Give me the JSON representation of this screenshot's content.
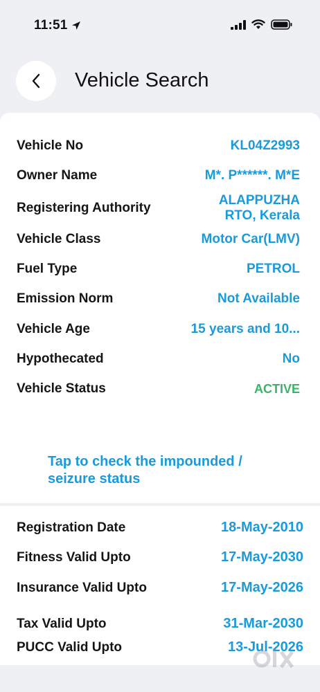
{
  "status_bar": {
    "time": "11:51"
  },
  "header": {
    "title": "Vehicle Search"
  },
  "details": [
    {
      "label": "Vehicle No",
      "value": "KL04Z2993"
    },
    {
      "label": "Owner Name",
      "value": "M*. P******. M*E"
    },
    {
      "label": "Registering Authority",
      "value": "ALAPPUZHA RTO, Kerala"
    },
    {
      "label": "Vehicle Class",
      "value": "Motor Car(LMV)"
    },
    {
      "label": "Fuel Type",
      "value": "PETROL"
    },
    {
      "label": "Emission Norm",
      "value": "Not Available"
    },
    {
      "label": "Vehicle Age",
      "value": "15 years and 10..."
    },
    {
      "label": "Hypothecated",
      "value": "No"
    },
    {
      "label": "Vehicle Status",
      "value": "ACTIVE"
    }
  ],
  "impound_link": "Tap to check the impounded / seizure status",
  "validity": [
    {
      "label": "Registration Date",
      "value": "18-May-2010"
    },
    {
      "label": "Fitness Valid Upto",
      "value": "17-May-2030"
    },
    {
      "label": "Insurance Valid Upto",
      "value": "17-May-2026"
    },
    {
      "label": "Tax Valid Upto",
      "value": "31-Mar-2030"
    },
    {
      "label": "PUCC Valid Upto",
      "value": "13-Jul-2026"
    }
  ],
  "colors": {
    "accent": "#1A9ADB",
    "status_active": "#39B56A",
    "background": "#EEF0F3"
  },
  "icons": [
    "location-arrow-icon",
    "cellular-signal-icon",
    "wifi-icon",
    "battery-icon",
    "chevron-left-icon",
    "olx-watermark-icon"
  ]
}
